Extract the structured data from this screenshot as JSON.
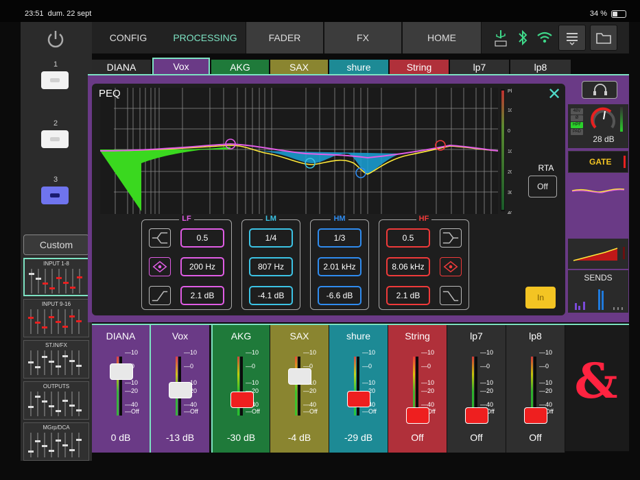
{
  "status": {
    "time": "23:51",
    "date": "dum. 22 sept",
    "battery": "34 %"
  },
  "scenes": [
    {
      "label": "1",
      "active": false
    },
    {
      "label": "2",
      "active": false
    },
    {
      "label": "3",
      "active": true
    }
  ],
  "sidebar": {
    "custom": "Custom",
    "banks": [
      "INPUT 1-8",
      "INPUT 9-16",
      "ST.IN/FX",
      "OUTPUTS",
      "MGrp/DCA"
    ]
  },
  "nav": {
    "config": "CONFIG",
    "processing": "PROCESSING",
    "fader": "FADER",
    "fx": "FX",
    "home": "HOME"
  },
  "channel_tabs": [
    {
      "label": "DIANA",
      "color": "#2a2a2a"
    },
    {
      "label": "Vox",
      "color": "#6a3a86"
    },
    {
      "label": "AKG",
      "color": "#1f7a3a"
    },
    {
      "label": "SAX",
      "color": "#8a8530"
    },
    {
      "label": "shure",
      "color": "#1d8a95"
    },
    {
      "label": "String",
      "color": "#b0303a"
    },
    {
      "label": "lp7",
      "color": "#2f2f2f"
    },
    {
      "label": "lp8",
      "color": "#2f2f2f"
    }
  ],
  "peq": {
    "title": "PEQ",
    "meter_scale": [
      "Pk",
      "10",
      "0",
      "10",
      "20",
      "30",
      "40"
    ],
    "rta_label": "RTA",
    "rta_value": "Off",
    "in_label": "In",
    "bands": [
      {
        "name": "LF",
        "color": "#e15de6",
        "q": "0.5",
        "freq": "200 Hz",
        "gain": "2.1 dB"
      },
      {
        "name": "LM",
        "color": "#3cc4e6",
        "q": "1/4",
        "freq": "807 Hz",
        "gain": "-4.1 dB"
      },
      {
        "name": "HM",
        "color": "#2f8cf0",
        "q": "1/3",
        "freq": "2.01 kHz",
        "gain": "-6.6 dB"
      },
      {
        "name": "HF",
        "color": "#f03a3a",
        "q": "0.5",
        "freq": "8.06 kHz",
        "gain": "2.1 dB"
      }
    ]
  },
  "preamp": {
    "gain": "28 dB",
    "badges": [
      "48V",
      "Ø",
      "HPF",
      "PAD"
    ],
    "gate": "GATE"
  },
  "sends_label": "SENDS",
  "strips": [
    {
      "name": "DIANA",
      "value": "0 dB",
      "bg": "#6a3a86",
      "knob": "#e8e8e8",
      "fader_level": 0.74
    },
    {
      "name": "Vox",
      "value": "-13 dB",
      "bg": "#6a3a86",
      "knob": "#e8e8e8",
      "fader_level": 0.43
    },
    {
      "name": "AKG",
      "value": "-30 dB",
      "bg": "#1f7a3a",
      "knob": "#ee1f1f",
      "fader_level": 0.27
    },
    {
      "name": "SAX",
      "value": "-4 dB",
      "bg": "#8a8530",
      "knob": "#e8e8e8",
      "fader_level": 0.66
    },
    {
      "name": "shure",
      "value": "-29 dB",
      "bg": "#1d8a95",
      "knob": "#ee1f1f",
      "fader_level": 0.28
    },
    {
      "name": "String",
      "value": "Off",
      "bg": "#b0303a",
      "knob": "#ee1f1f",
      "fader_level": 0.0
    },
    {
      "name": "lp7",
      "value": "Off",
      "bg": "#2f2f2f",
      "knob": "#ee1f1f",
      "fader_level": 0.0
    },
    {
      "name": "lp8",
      "value": "Off",
      "bg": "#2f2f2f",
      "knob": "#ee1f1f",
      "fader_level": 0.0
    }
  ],
  "fader_scale": [
    "10",
    "0",
    "10",
    "20",
    "40",
    "Off"
  ],
  "logo": "&"
}
